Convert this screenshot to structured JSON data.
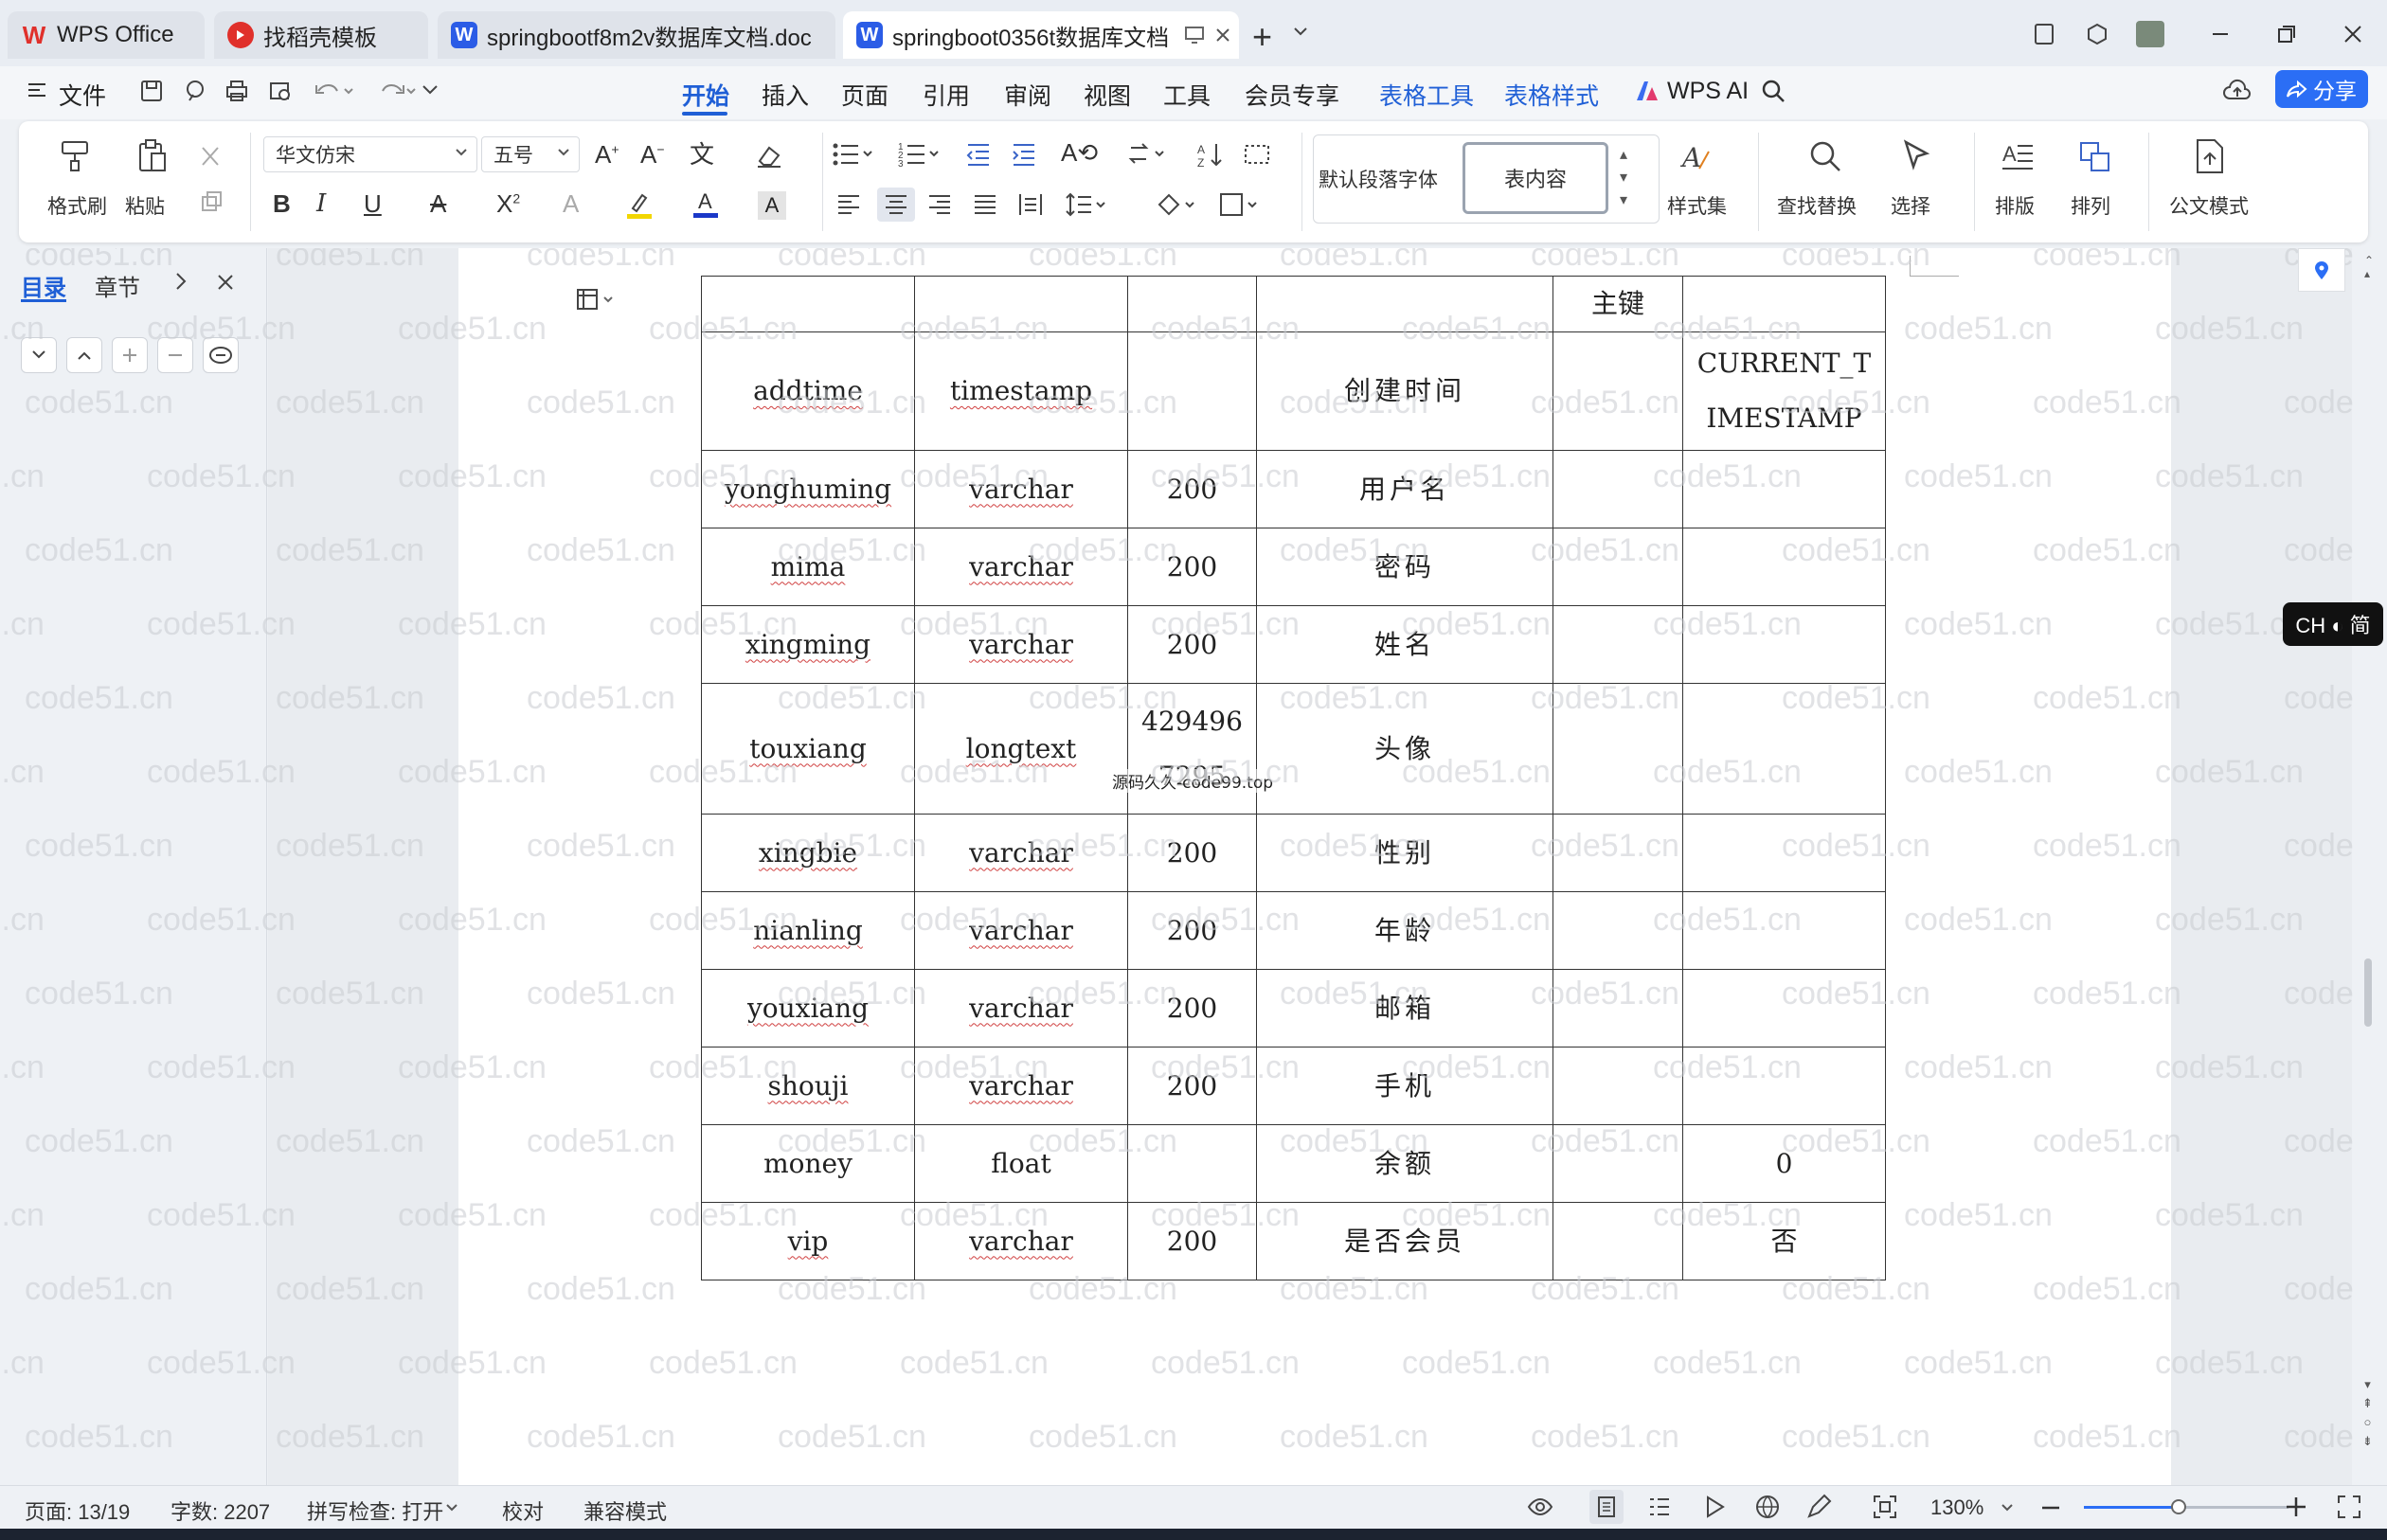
{
  "titlebar": {
    "tabs": [
      {
        "label": "WPS Office",
        "logo": "W",
        "logo_color": "#e0302b"
      },
      {
        "label": "找稻壳模板",
        "logo": "",
        "logo_color": "#e0302b"
      },
      {
        "label": "springbootf8m2v数据库文档.doc",
        "logo": "W",
        "logo_color": "#2b5ce6"
      },
      {
        "label": "springboot0356t数据库文档",
        "logo": "W",
        "logo_color": "#2b5ce6"
      }
    ],
    "new_tab": "+"
  },
  "menubar": {
    "file": "文件",
    "items": [
      "开始",
      "插入",
      "页面",
      "引用",
      "审阅",
      "视图",
      "工具",
      "会员专享"
    ],
    "context_items": [
      "表格工具",
      "表格样式"
    ],
    "ai": "WPS AI",
    "share": "分享"
  },
  "ribbon": {
    "format_painter": "格式刷",
    "paste": "粘贴",
    "font_name": "华文仿宋",
    "font_size": "五号",
    "style_default": "默认段落字体",
    "style_current": "表内容",
    "style_set": "样式集",
    "find_replace": "查找替换",
    "select": "选择",
    "layout": "排版",
    "arrange": "排列",
    "official_mode": "公文模式",
    "bold": "B",
    "italic": "I",
    "underline": "U"
  },
  "leftnav": {
    "tab_toc": "目录",
    "tab_chapter": "章节"
  },
  "table": {
    "rows": [
      [
        "",
        "",
        "",
        "",
        "主键",
        ""
      ],
      [
        "addtime",
        "timestamp",
        "",
        "创建时间",
        "",
        "CURRENT_TIMESTAMP"
      ],
      [
        "yonghuming",
        "varchar",
        "200",
        "用户名",
        "",
        ""
      ],
      [
        "mima",
        "varchar",
        "200",
        "密码",
        "",
        ""
      ],
      [
        "xingming",
        "varchar",
        "200",
        "姓名",
        "",
        ""
      ],
      [
        "touxiang",
        "longtext",
        "4294967295",
        "头像",
        "",
        ""
      ],
      [
        "xingbie",
        "varchar",
        "200",
        "性别",
        "",
        ""
      ],
      [
        "nianling",
        "varchar",
        "200",
        "年龄",
        "",
        ""
      ],
      [
        "youxiang",
        "varchar",
        "200",
        "邮箱",
        "",
        ""
      ],
      [
        "shouji",
        "varchar",
        "200",
        "手机",
        "",
        ""
      ],
      [
        "money",
        "float",
        "",
        "余额",
        "",
        "0"
      ],
      [
        "vip",
        "varchar",
        "200",
        "是否会员",
        "",
        "否"
      ]
    ]
  },
  "overlay_text": "源码久久-code99.top",
  "watermark": "code51.cn",
  "ime": "CH ◐ 简",
  "statusbar": {
    "page": "页面: 13/19",
    "words": "字数: 2207",
    "spell": "拼写检查: 打开",
    "proof": "校对",
    "compat": "兼容模式",
    "zoom": "130%"
  }
}
